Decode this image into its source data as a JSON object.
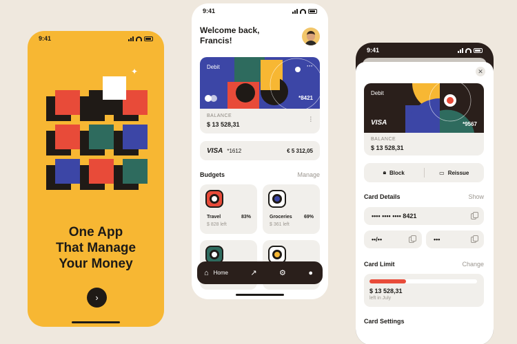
{
  "colors": {
    "background": "#efe8de",
    "yellow": "#f7b733",
    "dark": "#2a1f1b",
    "blue": "#3c46a6",
    "red": "#e84b39",
    "green": "#2e6b5e"
  },
  "phone1": {
    "time": "9:41",
    "title_line1": "One App",
    "title_line2": "That Manage",
    "title_line3": "Your Money",
    "next_icon": "chevron-right-icon"
  },
  "phone2": {
    "time": "9:41",
    "welcome_line1": "Welcome back,",
    "welcome_line2": "Francis!",
    "card": {
      "type": "Debit",
      "number": "*8421",
      "more_icon": "more-icon",
      "balance_label": "BALANCE",
      "balance": "$ 13 528,31",
      "settings_icon": "sliders-icon"
    },
    "visa_row": {
      "brand": "VISA",
      "number": "*1612",
      "amount": "€ 5 312,05"
    },
    "budgets": {
      "title": "Budgets",
      "action": "Manage",
      "items": [
        {
          "name": "Travel",
          "percent": "83%",
          "left": "$ 828 left",
          "color": "#e84b39"
        },
        {
          "name": "Groceries",
          "percent": "69%",
          "left": "$ 361 left",
          "color": "#3c46a6"
        },
        {
          "name": "",
          "percent": "",
          "left": "",
          "color": "#2e6b5e"
        },
        {
          "name": "",
          "percent": "",
          "left": "",
          "color": "#f7b733"
        }
      ]
    },
    "tabbar": {
      "home_label": "Home",
      "tabs": [
        "home-icon",
        "arrow-up-right-icon",
        "gear-icon",
        "user-icon"
      ]
    }
  },
  "phone3": {
    "time": "9:41",
    "card": {
      "type": "Debit",
      "brand": "VISA",
      "number": "*9567",
      "balance_label": "BALANCE",
      "balance": "$ 13 528,31"
    },
    "actions": {
      "block": "Block",
      "reissue": "Reissue"
    },
    "card_details": {
      "title": "Card Details",
      "action": "Show",
      "number_masked": "•••• •••• •••• 8421",
      "expiry_masked": "••/••",
      "cvv_masked": "•••"
    },
    "card_limit": {
      "title": "Card Limit",
      "action": "Change",
      "amount": "$ 13 528,31",
      "period": "left in July",
      "used_fraction": 0.34
    },
    "card_settings": {
      "title": "Card Settings"
    }
  }
}
